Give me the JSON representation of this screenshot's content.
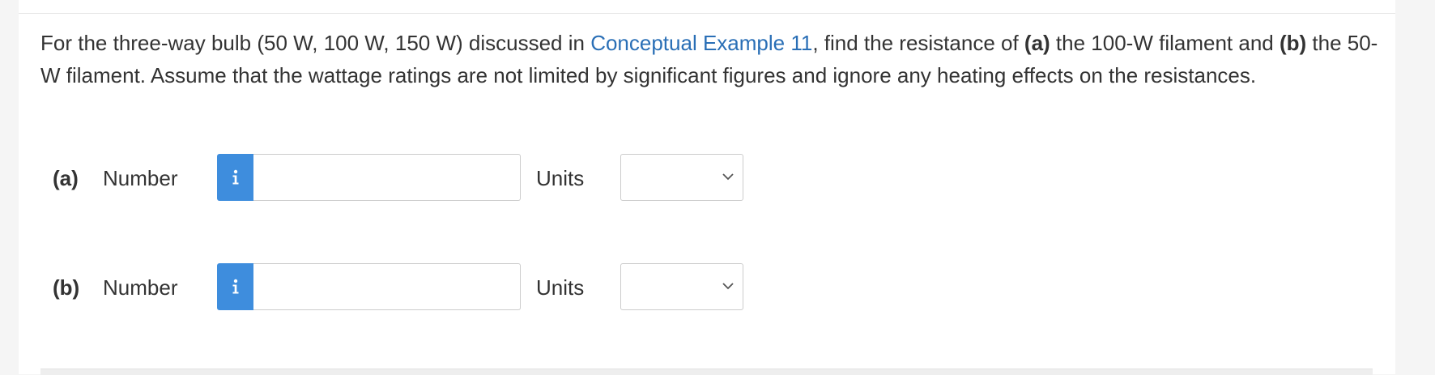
{
  "question": {
    "text_1": "For the three-way bulb (50 W, 100 W, 150 W) discussed in ",
    "link": "Conceptual Example 11",
    "text_2": ", find the resistance of ",
    "part_a_ref": "(a)",
    "text_3": " the 100-W filament and ",
    "part_b_ref": "(b)",
    "text_4": " the 50-W filament. Assume that the wattage ratings are not limited by significant figures and ignore any heating effects on the resistances."
  },
  "part_a": {
    "label": "(a)",
    "number_label": "Number",
    "number_value": "",
    "units_label": "Units",
    "units_selected": ""
  },
  "part_b": {
    "label": "(b)",
    "number_label": "Number",
    "number_value": "",
    "units_label": "Units",
    "units_selected": ""
  },
  "icons": {
    "info": "info-icon",
    "dropdown": "chevron-down-icon"
  },
  "colors": {
    "link": "#2a6fb6",
    "info_button": "#3e8ddd",
    "text": "#333333"
  }
}
